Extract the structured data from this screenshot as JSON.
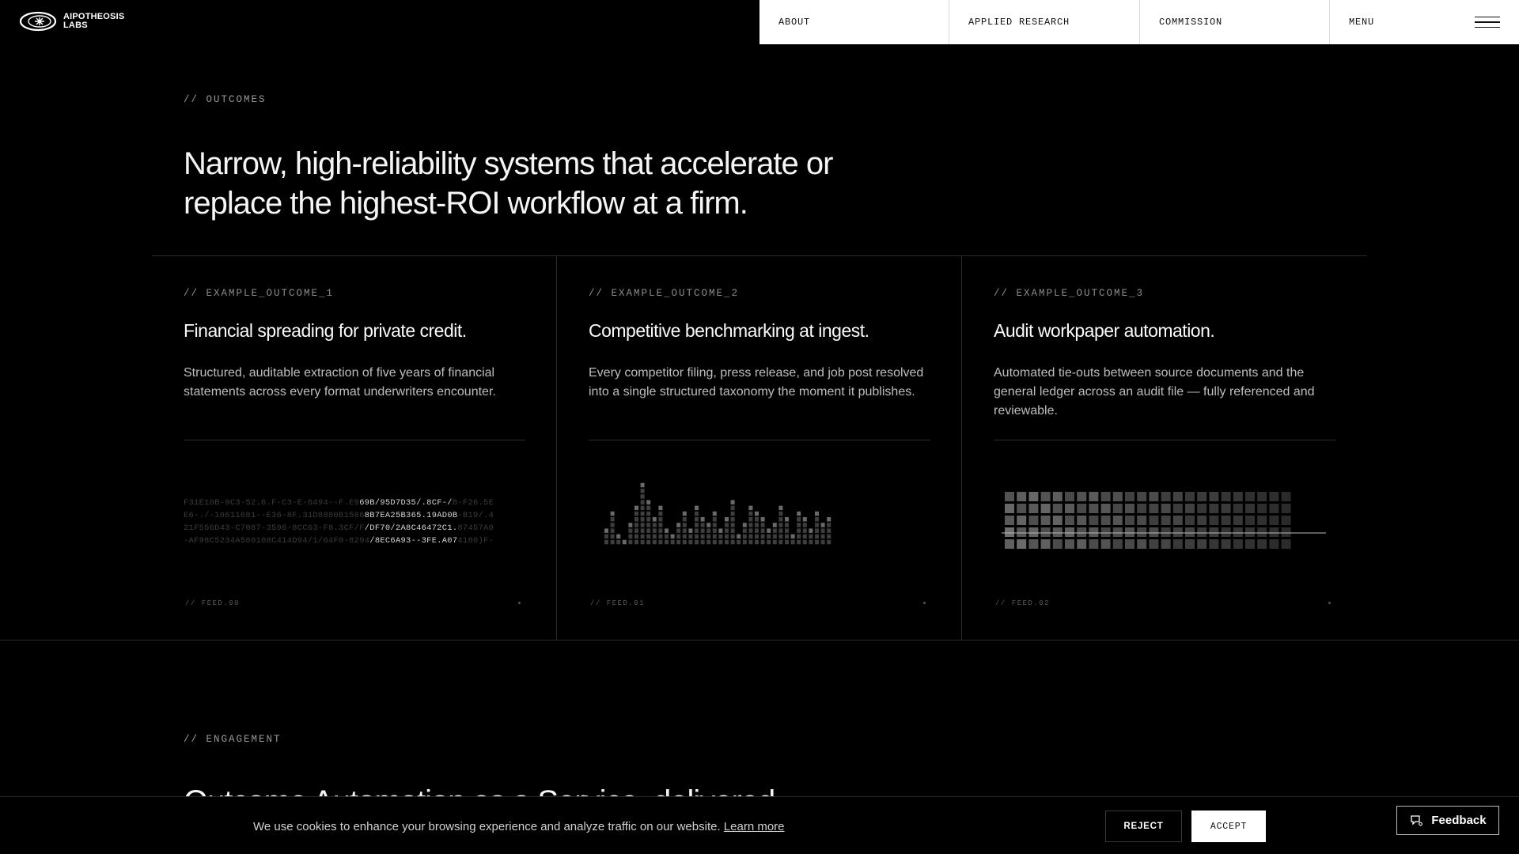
{
  "brand": {
    "line1": "AIPOTHEOSIS",
    "line2": "LABS",
    "logo_icon": "aperture-ring-icon"
  },
  "nav": {
    "items": [
      "ABOUT",
      "APPLIED RESEARCH",
      "COMMISSION"
    ],
    "menu_label": "MENU",
    "menu_icon": "hamburger-icon"
  },
  "outcomes": {
    "eyebrow": "// OUTCOMES",
    "headline": "Narrow, high-reliability systems that accelerate or replace the highest-ROI workflow at a firm.",
    "cards": [
      {
        "tag": "// EXAMPLE_OUTCOME_1",
        "title": "Financial spreading for private credit.",
        "description": "Structured, auditable extraction of five years of financial statements across every format underwriters encounter.",
        "feed": "// FEED.00"
      },
      {
        "tag": "// EXAMPLE_OUTCOME_2",
        "title": "Competitive benchmarking at ingest.",
        "description": "Every competitor filing, press release, and job post resolved into a single structured taxonomy the moment it publishes.",
        "feed": "// FEED.01"
      },
      {
        "tag": "// EXAMPLE_OUTCOME_3",
        "title": "Audit workpaper automation.",
        "description": "Automated tie-outs between source documents and the general ledger across an audit file — fully referenced and reviewable.",
        "feed": "// FEED.02"
      }
    ],
    "hex_feed": [
      {
        "dim_pre": "F31E10B-9C3-52.6.F-C3-E-6494--F.E9",
        "bright": "69B/95D7D35/.8CF-/",
        "dim_post": "B-F26.5E"
      },
      {
        "dim_pre": "E6-./-10611681--E36-8F.31D8880B1586",
        "bright": "8B7EA25B365.19AD0B",
        "dim_post": "-B19/.4"
      },
      {
        "dim_pre": "21F556D43-C7087-3596-8CC63-F8.3CF/F",
        "bright": "/DF70/2A8C46472C1.",
        "dim_post": "87457A0"
      },
      {
        "dim_pre": "-AF98C5234A580108C414D94/1/64F0-8294",
        "bright": "/8EC6A93--3FE.A07",
        "dim_post": "4180)F-"
      }
    ]
  },
  "engagement": {
    "eyebrow": "// ENGAGEMENT",
    "title": "Outcome Automation as a Service, delivered."
  },
  "cookie": {
    "text": "We use cookies to enhance your browsing experience and analyze traffic on our website.",
    "link": "Learn more",
    "reject": "REJECT",
    "accept": "ACCEPT"
  },
  "feedback": {
    "label": "Feedback",
    "icon": "feedback-chat-icon"
  }
}
